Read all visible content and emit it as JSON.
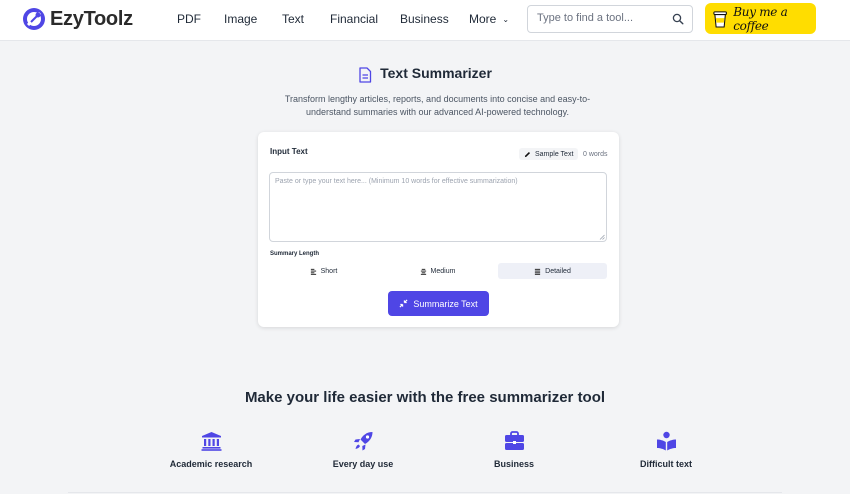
{
  "brand": {
    "name": "EzyToolz",
    "accent_color": "#4f46e5",
    "logo_icon": "ezytoolz-logo-icon"
  },
  "nav": {
    "items": [
      {
        "label": "PDF"
      },
      {
        "label": "Image"
      },
      {
        "label": "Text"
      },
      {
        "label": "Financial"
      },
      {
        "label": "Business"
      },
      {
        "label": "More"
      }
    ]
  },
  "search": {
    "placeholder": "Type to find a tool...",
    "icon": "search-icon"
  },
  "coffee": {
    "label": "Buy me a coffee",
    "color": "#ffdd00",
    "icon": "coffee-cup-icon"
  },
  "hero": {
    "title": "Text Summarizer",
    "title_icon": "document-icon",
    "subtitle": "Transform lengthy articles, reports, and documents into concise and easy-to-understand summaries with our advanced AI-powered technology."
  },
  "card": {
    "input_label": "Input Text",
    "sample_button": "Sample Text",
    "word_count": "0 words",
    "textarea_placeholder": "Paste or type your text here... (Minimum 10 words for effective summarization)",
    "textarea_value": "",
    "length_label": "Summary Length",
    "length_options": [
      {
        "label": "Short",
        "selected": false
      },
      {
        "label": "Medium",
        "selected": false
      },
      {
        "label": "Detailed",
        "selected": true
      }
    ],
    "submit_label": "Summarize Text"
  },
  "features": {
    "title": "Make your life easier with the free summarizer tool",
    "items": [
      {
        "label": "Academic research",
        "icon": "university-icon"
      },
      {
        "label": "Every day use",
        "icon": "rocket-icon"
      },
      {
        "label": "Business",
        "icon": "briefcase-icon"
      },
      {
        "label": "Difficult text",
        "icon": "book-reader-icon"
      }
    ]
  }
}
